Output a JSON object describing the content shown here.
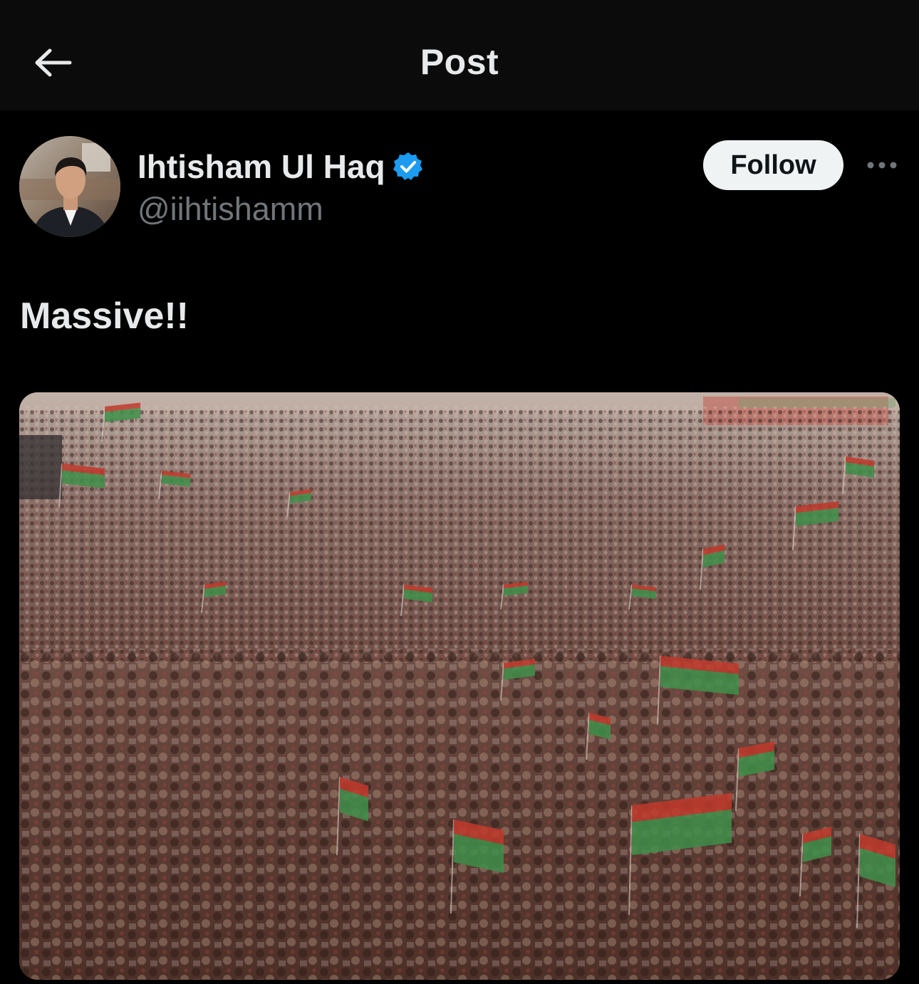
{
  "header": {
    "title": "Post",
    "back_icon": "arrow-left-icon"
  },
  "author": {
    "display_name": "Ihtisham Ul Haq",
    "handle": "@iihtishamm",
    "verified": true,
    "verified_icon": "verified-badge-icon",
    "avatar_description_icon": "avatar"
  },
  "actions": {
    "follow_label": "Follow",
    "more_icon": "more-horizontal-icon"
  },
  "post": {
    "text": "Massive!!"
  },
  "media": {
    "type": "photo"
  },
  "colors": {
    "background": "#000000",
    "header_background": "#0b0b0b",
    "primary_text": "#e7e9ea",
    "secondary_text": "#71767b",
    "follow_button_bg": "#eff3f4",
    "follow_button_text": "#0f1419",
    "verified_blue": "#1d9bf0"
  }
}
